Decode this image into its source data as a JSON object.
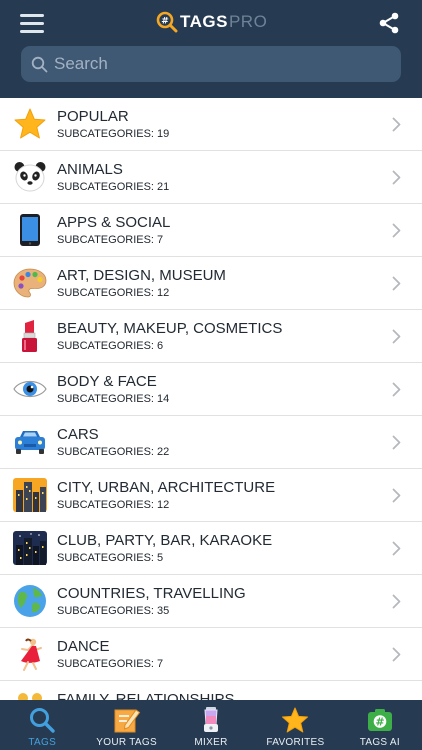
{
  "header": {
    "logo_main": "TAGS",
    "logo_sub": "PRO"
  },
  "search": {
    "placeholder": "Search"
  },
  "categories": [
    {
      "title": "POPULAR",
      "subcategories": "SUBCATEGORIES: 19",
      "icon": "star-icon"
    },
    {
      "title": "ANIMALS",
      "subcategories": "SUBCATEGORIES: 21",
      "icon": "panda-icon"
    },
    {
      "title": "APPS & SOCIAL",
      "subcategories": "SUBCATEGORIES: 7",
      "icon": "smartphone-icon"
    },
    {
      "title": "ART, DESIGN, MUSEUM",
      "subcategories": "SUBCATEGORIES: 12",
      "icon": "palette-icon"
    },
    {
      "title": "BEAUTY, MAKEUP, COSMETICS",
      "subcategories": "SUBCATEGORIES: 6",
      "icon": "lipstick-icon"
    },
    {
      "title": "BODY & FACE",
      "subcategories": "SUBCATEGORIES: 14",
      "icon": "eye-icon"
    },
    {
      "title": "CARS",
      "subcategories": "SUBCATEGORIES: 22",
      "icon": "car-icon"
    },
    {
      "title": "CITY, URBAN, ARCHITECTURE",
      "subcategories": "SUBCATEGORIES: 12",
      "icon": "city-icon"
    },
    {
      "title": "CLUB, PARTY, BAR, KARAOKE",
      "subcategories": "SUBCATEGORIES: 5",
      "icon": "night-city-icon"
    },
    {
      "title": "COUNTRIES, TRAVELLING",
      "subcategories": "SUBCATEGORIES: 35",
      "icon": "globe-icon"
    },
    {
      "title": "DANCE",
      "subcategories": "SUBCATEGORIES: 7",
      "icon": "dancer-icon"
    },
    {
      "title": "FAMILY, RELATIONSHIPS",
      "subcategories": "",
      "icon": "family-icon"
    }
  ],
  "tabs": [
    {
      "label": "TAGS",
      "icon": "search-icon",
      "active": true
    },
    {
      "label": "YOUR TAGS",
      "icon": "edit-icon",
      "active": false
    },
    {
      "label": "MIXER",
      "icon": "blender-icon",
      "active": false
    },
    {
      "label": "FAVORITES",
      "icon": "star-icon",
      "active": false
    },
    {
      "label": "TAGS AI",
      "icon": "camera-icon",
      "active": false
    }
  ],
  "colors": {
    "header_bg": "#263b52",
    "search_bg": "#3f5873",
    "active_tab": "#43a0df",
    "logo_accent": "#f5a623"
  }
}
